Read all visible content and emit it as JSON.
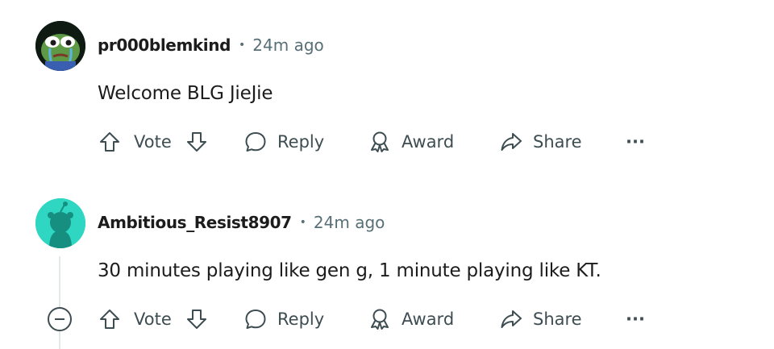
{
  "comments": [
    {
      "username": "pr000blemkind",
      "separator": "•",
      "time": "24m ago",
      "text": "Welcome BLG JieJie",
      "actions": {
        "vote": "Vote",
        "reply": "Reply",
        "award": "Award",
        "share": "Share",
        "more": "···"
      }
    },
    {
      "username": "Ambitious_Resist8907",
      "separator": "•",
      "time": "24m ago",
      "text": "30 minutes playing like gen g, 1 minute playing like KT.",
      "actions": {
        "vote": "Vote",
        "reply": "Reply",
        "award": "Award",
        "share": "Share",
        "more": "···"
      }
    }
  ],
  "colors": {
    "text": "#1c1c1c",
    "meta": "#576f76",
    "icon": "#3d4d52",
    "avatar2_bg": "#2fd6c2"
  }
}
